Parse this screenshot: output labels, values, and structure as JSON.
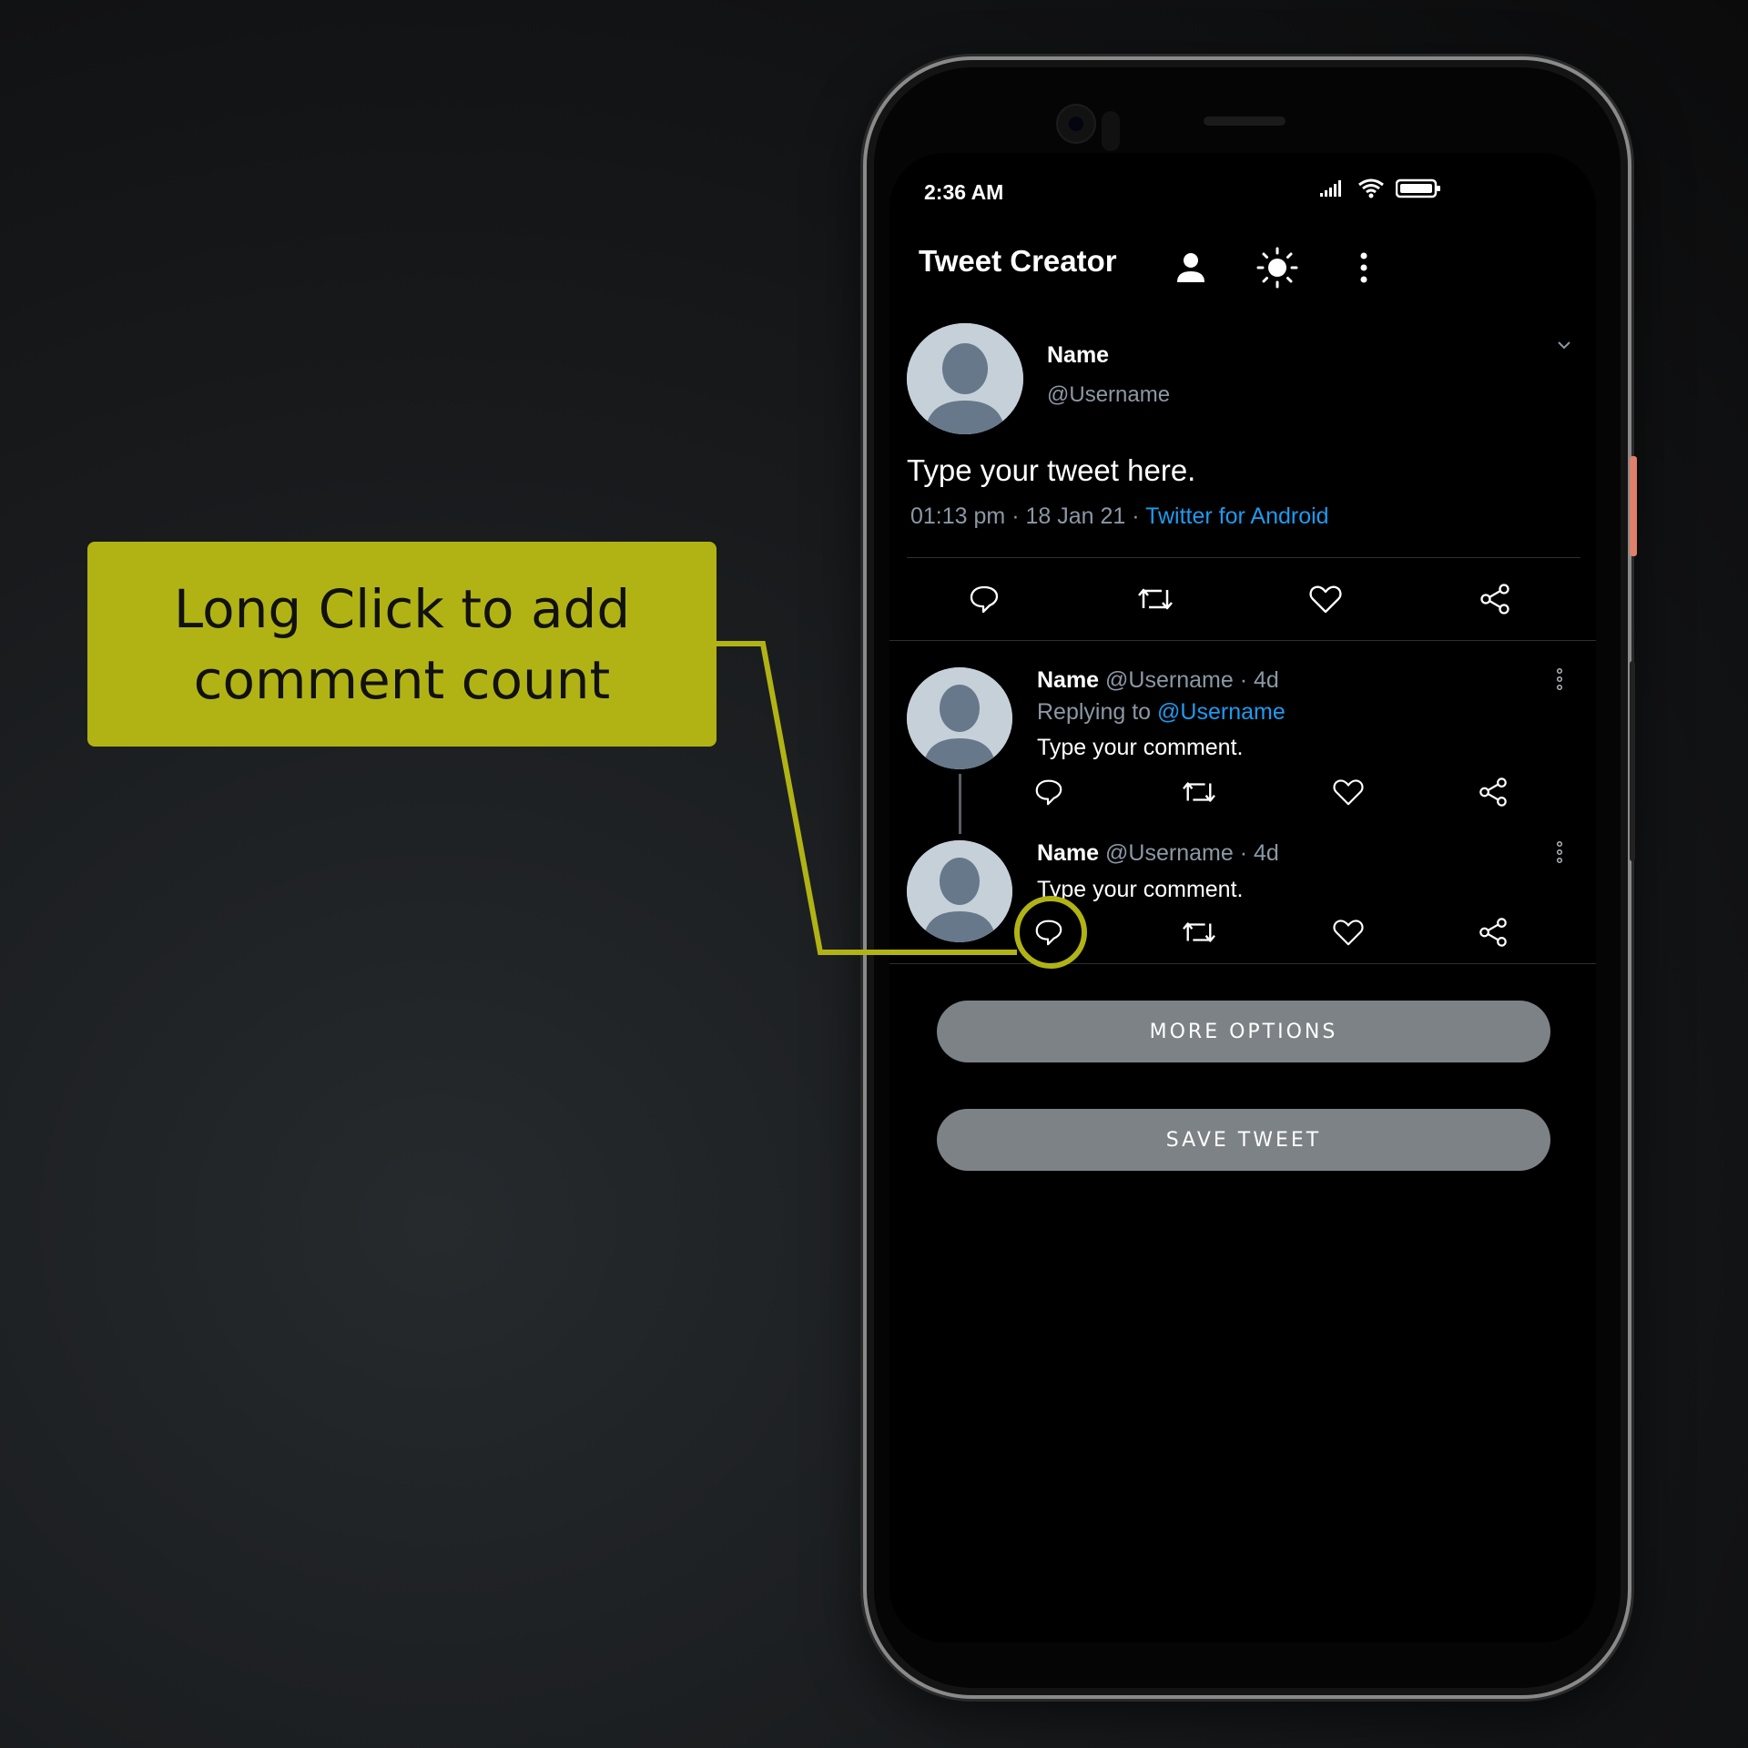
{
  "annotation": {
    "callout_line1": "Long Click to add",
    "callout_line2": "comment count",
    "accent_color": "#b1b315"
  },
  "status_bar": {
    "time": "2:36 AM",
    "icons": [
      "signal-icon",
      "wifi-icon",
      "battery-icon"
    ]
  },
  "app_bar": {
    "title": "Tweet Creator",
    "actions": [
      "person-icon",
      "brightness-icon",
      "more-vert-icon"
    ]
  },
  "main_tweet": {
    "name": "Name",
    "username": "@Username",
    "text": "Type your tweet here.",
    "time": "01:13 pm",
    "date": "18 Jan 21",
    "sep": "·",
    "source": "Twitter for Android",
    "actions": [
      "comment-icon",
      "retweet-icon",
      "like-icon",
      "share-icon"
    ]
  },
  "replies": [
    {
      "name": "Name",
      "username": "@Username",
      "age": "· 4d",
      "replying_prefix": "Replying to",
      "replying_to": "@Username",
      "text": "Type your comment."
    },
    {
      "name": "Name",
      "username": "@Username",
      "age": "· 4d",
      "text": "Type your comment."
    }
  ],
  "buttons": {
    "more_options": "MORE OPTIONS",
    "save_tweet": "SAVE TWEET"
  },
  "colors": {
    "link": "#1d9bf0",
    "muted": "#8b98a5",
    "button_bg": "#7d8286",
    "avatar_bg": "#c6d0d8",
    "avatar_fg": "#67788a"
  }
}
